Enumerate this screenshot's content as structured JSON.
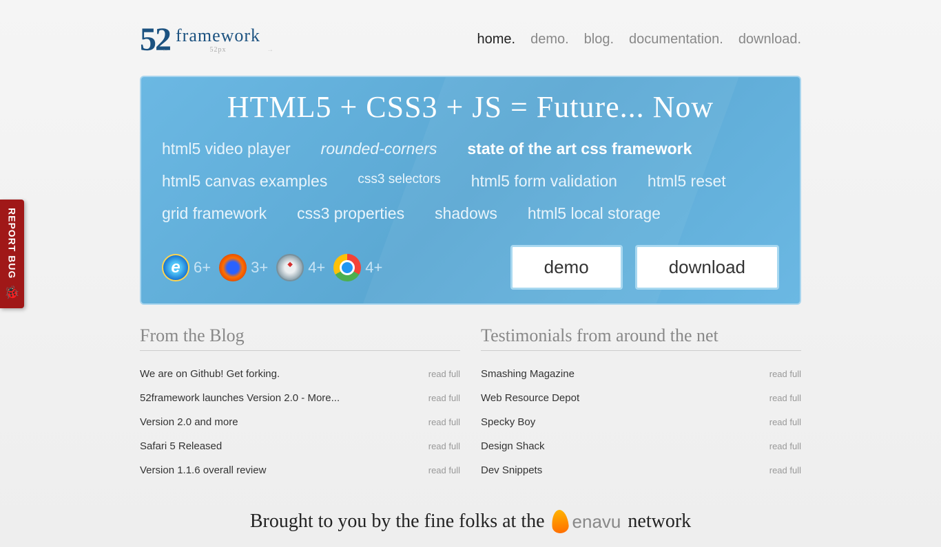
{
  "logo": {
    "number": "52",
    "text": "framework",
    "sub": "52px"
  },
  "nav": [
    {
      "label": "home.",
      "active": true
    },
    {
      "label": "demo.",
      "active": false
    },
    {
      "label": "blog.",
      "active": false
    },
    {
      "label": "documentation.",
      "active": false
    },
    {
      "label": "download.",
      "active": false
    }
  ],
  "hero": {
    "title": "HTML5  +  CSS3  + JS = Future... Now",
    "features": [
      {
        "text": "html5 video player",
        "style": ""
      },
      {
        "text": "rounded-corners",
        "style": "italic"
      },
      {
        "text": "state of the art css framework",
        "style": "bold"
      },
      {
        "text": "html5 canvas examples",
        "style": ""
      },
      {
        "text": "css3 selectors",
        "style": "small"
      },
      {
        "text": "html5 form validation",
        "style": ""
      },
      {
        "text": "html5 reset",
        "style": ""
      },
      {
        "text": "grid framework",
        "style": ""
      },
      {
        "text": "css3 properties",
        "style": ""
      },
      {
        "text": "shadows",
        "style": ""
      },
      {
        "text": "html5 local storage",
        "style": ""
      }
    ],
    "browsers": [
      {
        "name": "ie",
        "version": "6+"
      },
      {
        "name": "firefox",
        "version": "3+"
      },
      {
        "name": "safari",
        "version": "4+"
      },
      {
        "name": "chrome",
        "version": "4+"
      }
    ],
    "buttons": {
      "demo": "demo",
      "download": "download"
    }
  },
  "blog": {
    "title": "From the Blog",
    "read": "read full",
    "items": [
      "We are on Github! Get forking.",
      "52framework launches Version 2.0 - More...",
      "Version 2.0 and more",
      "Safari 5 Released",
      "Version 1.1.6 overall review"
    ]
  },
  "testimonials": {
    "title": "Testimonials from around the net",
    "read": "read full",
    "items": [
      "Smashing Magazine",
      "Web Resource Depot",
      "Specky Boy",
      "Design Shack",
      "Dev Snippets"
    ]
  },
  "footer": {
    "pre": "Brought to you by the fine folks at the",
    "brand": "enavu",
    "post": "network"
  },
  "report": "REPORT BUG"
}
